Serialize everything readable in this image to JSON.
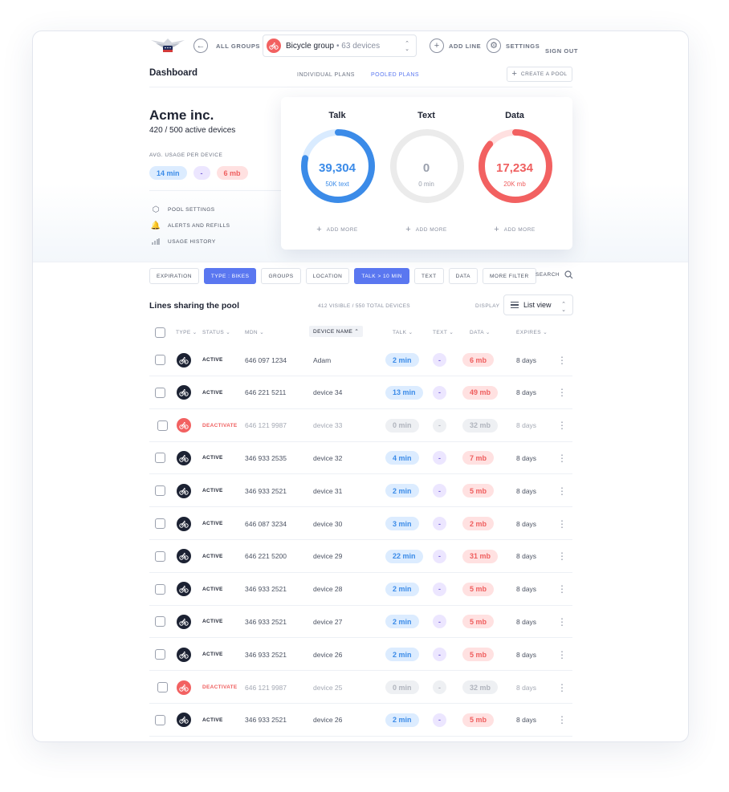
{
  "colors": {
    "accent": "#5a77f0",
    "talk": "#3b8be8",
    "text": "#7a66d9",
    "data": "#ef5f5f",
    "dark": "#1c2233"
  },
  "nav": {
    "all_groups": "ALL GROUPS",
    "group_name": "Bicycle group",
    "group_devices": "• 63 devices",
    "add_line": "ADD LINE",
    "settings": "SETTINGS",
    "sign_out": "SIGN OUT"
  },
  "subnav": {
    "title": "Dashboard",
    "tabs": [
      "INDIVIDUAL PLANS",
      "POOLED PLANS"
    ],
    "active_tab": "POOLED PLANS",
    "create_pool": "CREATE A POOL"
  },
  "account": {
    "company": "Acme inc.",
    "active_devices": "420 / 500 active devices",
    "avg_label": "AVG. USAGE PER DEVICE",
    "avg_talk": "14 min",
    "avg_text": "-",
    "avg_data": "6 mb",
    "menu": [
      {
        "icon": "hexagon-gear-icon",
        "label": "POOL SETTINGS"
      },
      {
        "icon": "bell-icon",
        "label": "ALERTS AND REFILLS"
      },
      {
        "icon": "bar-chart-icon",
        "label": "USAGE HISTORY"
      }
    ]
  },
  "usage": [
    {
      "title": "Talk",
      "value": "39,304",
      "sub": "50K text",
      "fraction": 0.786,
      "color": "#3b8be8",
      "track": "#d9ebff"
    },
    {
      "title": "Text",
      "value": "0",
      "sub": "0 min",
      "fraction": 0,
      "color": "#9aa0ad",
      "track": "#ebebeb"
    },
    {
      "title": "Data",
      "value": "17,234",
      "sub": "20K mb",
      "fraction": 0.862,
      "color": "#f26161",
      "track": "#ffe0e0"
    }
  ],
  "add_more": "ADD MORE",
  "filters": [
    {
      "label": "EXPIRATION",
      "on": false
    },
    {
      "label": "TYPE : BIKES",
      "on": true
    },
    {
      "label": "GROUPS",
      "on": false
    },
    {
      "label": "LOCATION",
      "on": false
    },
    {
      "label": "TALK > 10 MIN",
      "on": true
    },
    {
      "label": "TEXT",
      "on": false
    },
    {
      "label": "DATA",
      "on": false
    },
    {
      "label": "MORE FILTER",
      "on": false
    }
  ],
  "search_label": "SEARCH",
  "list": {
    "title": "Lines sharing the pool",
    "counts": "412 VISIBLE / 550 TOTAL DEVICES",
    "display_label": "DISPLAY",
    "view": "List view"
  },
  "columns": [
    "TYPE",
    "STATUS",
    "MDN",
    "DEVICE NAME",
    "TALK",
    "TEXT",
    "DATA",
    "EXPIRES"
  ],
  "rows": [
    {
      "status": "ACTIVE",
      "mdn": "646 097 1234",
      "name": "Adam",
      "talk": "2 min",
      "text": "-",
      "data": "6 mb",
      "expires": "8 days"
    },
    {
      "status": "ACTIVE",
      "mdn": "646 221 5211",
      "name": "device 34",
      "talk": "13 min",
      "text": "-",
      "data": "49 mb",
      "expires": "8 days"
    },
    {
      "status": "DEACTIVATE",
      "mdn": "646 121 9987",
      "name": "device 33",
      "talk": "0 min",
      "text": "-",
      "data": "32 mb",
      "expires": "8 days"
    },
    {
      "status": "ACTIVE",
      "mdn": "346 933 2535",
      "name": "device 32",
      "talk": "4 min",
      "text": "-",
      "data": "7 mb",
      "expires": "8 days"
    },
    {
      "status": "ACTIVE",
      "mdn": "346 933 2521",
      "name": "device 31",
      "talk": "2 min",
      "text": "-",
      "data": "5 mb",
      "expires": "8 days"
    },
    {
      "status": "ACTIVE",
      "mdn": "646 087 3234",
      "name": "device 30",
      "talk": "3 min",
      "text": "-",
      "data": "2 mb",
      "expires": "8 days"
    },
    {
      "status": "ACTIVE",
      "mdn": "646 221 5200",
      "name": "device 29",
      "talk": "22 min",
      "text": "-",
      "data": "31 mb",
      "expires": "8 days"
    },
    {
      "status": "ACTIVE",
      "mdn": "346 933 2521",
      "name": "device 28",
      "talk": "2 min",
      "text": "-",
      "data": "5 mb",
      "expires": "8 days"
    },
    {
      "status": "ACTIVE",
      "mdn": "346 933 2521",
      "name": "device 27",
      "talk": "2 min",
      "text": "-",
      "data": "5 mb",
      "expires": "8 days"
    },
    {
      "status": "ACTIVE",
      "mdn": "346 933 2521",
      "name": "device 26",
      "talk": "2 min",
      "text": "-",
      "data": "5 mb",
      "expires": "8 days"
    },
    {
      "status": "DEACTIVATE",
      "mdn": "646 121 9987",
      "name": "device 25",
      "talk": "0 min",
      "text": "-",
      "data": "32 mb",
      "expires": "8 days"
    },
    {
      "status": "ACTIVE",
      "mdn": "346 933 2521",
      "name": "device 26",
      "talk": "2 min",
      "text": "-",
      "data": "5 mb",
      "expires": "8 days"
    }
  ]
}
